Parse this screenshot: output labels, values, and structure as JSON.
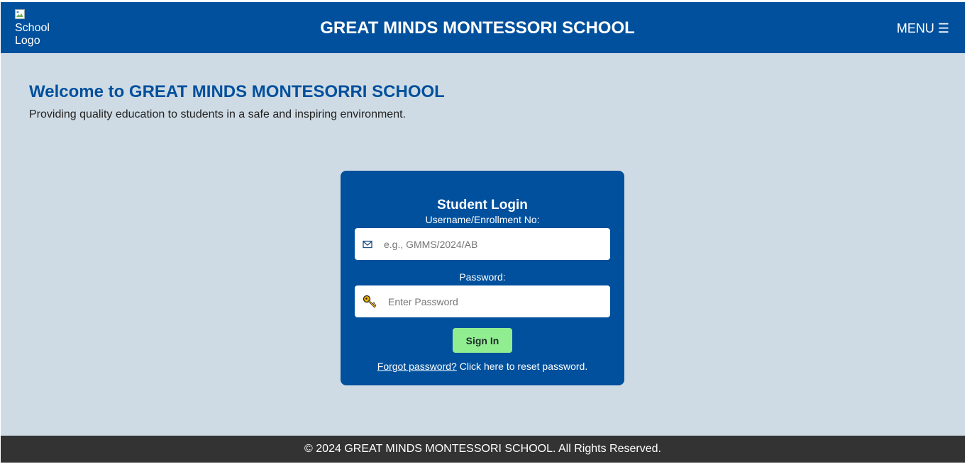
{
  "header": {
    "logo_alt": "School Logo",
    "title": "GREAT MINDS MONTESSORI SCHOOL",
    "menu_label": "MENU ☰"
  },
  "welcome": {
    "heading": "Welcome to GREAT MINDS MONTESORRI SCHOOL",
    "subtext": "Providing quality education to students in a safe and inspiring environment."
  },
  "login": {
    "title": "Student Login",
    "username_label": "Username/Enrollment No:",
    "username_placeholder": "e.g., GMMS/2024/AB",
    "username_icon": "mail-icon",
    "password_label": "Password:",
    "password_placeholder": "Enter Password",
    "password_icon": "key-icon",
    "signin_label": "Sign In",
    "forgot_link": "Forgot password?",
    "forgot_text": " Click here to reset password."
  },
  "footer": {
    "copyright": "© 2024 GREAT MINDS MONTESSORI SCHOOL. All Rights Reserved."
  },
  "colors": {
    "primary": "#00509d",
    "background": "#cfdbe4",
    "signin_button": "#90ee90",
    "footer": "#333333"
  }
}
